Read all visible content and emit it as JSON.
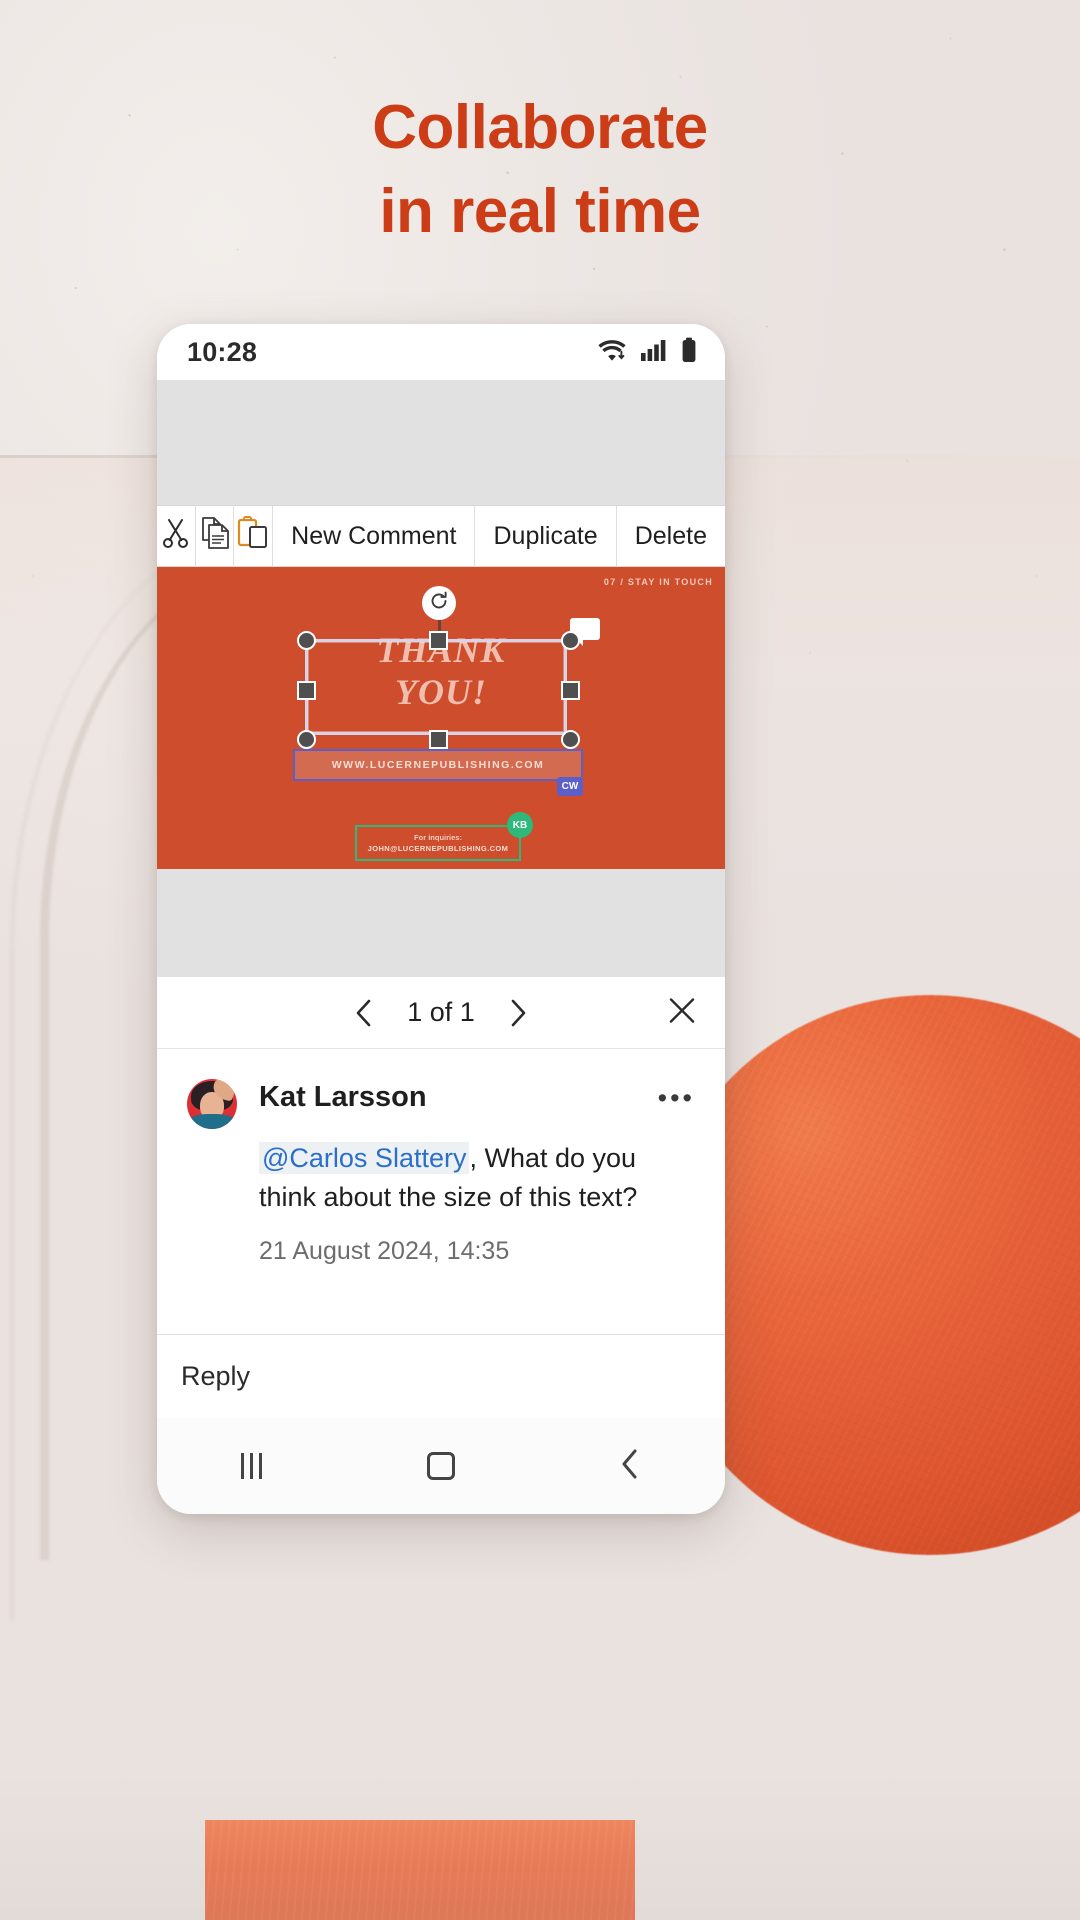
{
  "marketing": {
    "headline_line1": "Collaborate",
    "headline_line2": "in real time",
    "headline_color": "#cc3d17"
  },
  "phone": {
    "status_bar": {
      "time": "10:28",
      "icons": [
        "wifi-icon",
        "cellular-signal-icon",
        "battery-icon"
      ]
    },
    "context_menu": {
      "items": [
        {
          "type": "icon",
          "icon": "cut-scissors-icon",
          "label": "Cut"
        },
        {
          "type": "icon",
          "icon": "copy-icon",
          "label": "Copy"
        },
        {
          "type": "icon",
          "icon": "paste-clipboard-icon",
          "label": "Paste"
        },
        {
          "type": "text",
          "label": "New Comment"
        },
        {
          "type": "text",
          "label": "Duplicate"
        },
        {
          "type": "text",
          "label": "Delete"
        }
      ]
    },
    "slide": {
      "background_color": "#cd4d2c",
      "corner_label": "07  / STAY IN TOUCH",
      "title_line1": "THANK",
      "title_line2": "YOU!",
      "website": "WWW.LUCERNEPUBLISHING.COM",
      "inquiries_label": "For inquiries:",
      "inquiries_email": "JOHN@LUCERNEPUBLISHING.COM",
      "coeditors": [
        {
          "initials": "CW",
          "color": "#5b5fc7"
        },
        {
          "initials": "KB",
          "color": "#2eb87a"
        }
      ],
      "rotate_handle": "rotate-icon",
      "comment_marker": "comment-bubble-icon"
    },
    "comment_panel": {
      "nav": {
        "previous": "chevron-left-icon",
        "counter": "1 of 1",
        "next": "chevron-right-icon",
        "close": "close-icon"
      },
      "comment": {
        "author": "Kat Larsson",
        "avatar": "user-avatar",
        "overflow_menu": "•••",
        "mention": "@Carlos Slattery",
        "body": ", What do you think about the size of this text?",
        "timestamp": "21 August 2024, 14:35"
      },
      "reply_placeholder": "Reply"
    },
    "nav_bar": {
      "recents": "recents-icon",
      "home": "home-icon",
      "back": "back-icon"
    }
  }
}
